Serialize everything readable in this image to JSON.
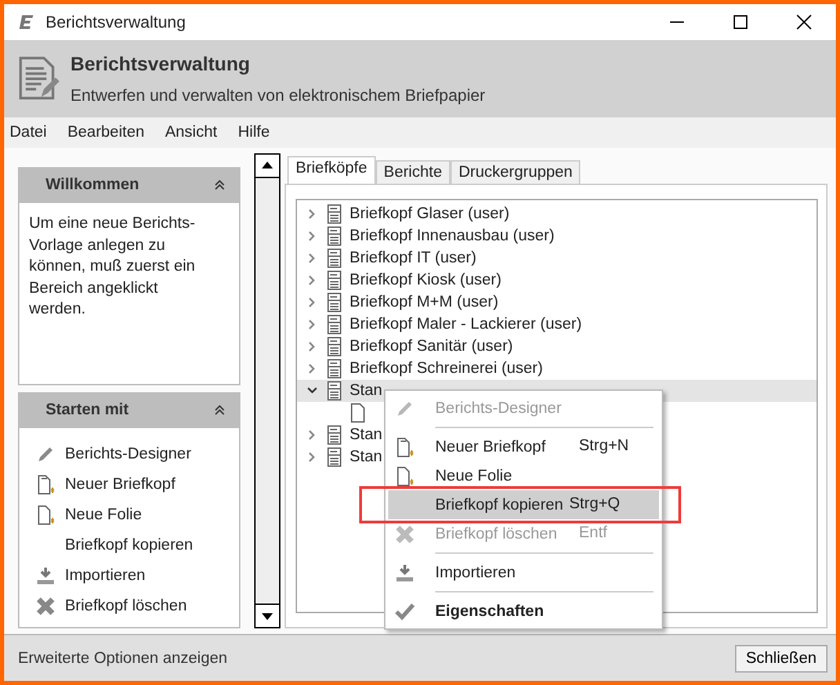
{
  "window": {
    "title": "Berichtsverwaltung"
  },
  "header": {
    "title": "Berichtsverwaltung",
    "subtitle": "Entwerfen und verwalten von elektronischem Briefpapier"
  },
  "menu": [
    "Datei",
    "Bearbeiten",
    "Ansicht",
    "Hilfe"
  ],
  "panels": [
    {
      "title": "Willkommen",
      "expanded": true,
      "kind": "text",
      "text": "Um eine neue Berichts-Vorlage anlegen zu können, muß zuerst ein Bereich angeklickt werden."
    },
    {
      "title": "Starten mit",
      "expanded": true,
      "kind": "actions",
      "items": [
        {
          "label": "Berichts-Designer",
          "kind": "pencil"
        },
        {
          "label": "Neuer Briefkopf",
          "kind": "newdoc"
        },
        {
          "label": "Neue Folie",
          "kind": "newpage"
        },
        {
          "label": "Briefkopf kopieren",
          "kind": "plain"
        },
        {
          "label": "Importieren",
          "kind": "import"
        },
        {
          "label": "Briefkopf löschen",
          "kind": "delete"
        }
      ]
    }
  ],
  "tabs": [
    {
      "label": "Briefköpfe",
      "selected": true
    },
    {
      "label": "Berichte",
      "selected": false
    },
    {
      "label": "Druckergruppen",
      "selected": false
    }
  ],
  "tree": [
    {
      "label": "Briefkopf Glaser (user)",
      "expanded": false,
      "selected": false
    },
    {
      "label": "Briefkopf Innenausbau (user)",
      "expanded": false,
      "selected": false
    },
    {
      "label": "Briefkopf IT (user)",
      "expanded": false,
      "selected": false
    },
    {
      "label": "Briefkopf Kiosk (user)",
      "expanded": false,
      "selected": false
    },
    {
      "label": "Briefkopf M+M (user)",
      "expanded": false,
      "selected": false
    },
    {
      "label": "Briefkopf Maler - Lackierer (user)",
      "expanded": false,
      "selected": false
    },
    {
      "label": "Briefkopf Sanitär (user)",
      "expanded": false,
      "selected": false
    },
    {
      "label": "Briefkopf Schreinerei (user)",
      "expanded": false,
      "selected": false
    },
    {
      "label": "Stan",
      "expanded": true,
      "selected": true,
      "children": [
        {
          "kind": "page"
        }
      ]
    },
    {
      "label": "Stan",
      "expanded": false,
      "selected": false
    },
    {
      "label": "Stan",
      "expanded": false,
      "selected": false
    }
  ],
  "context_menu": [
    {
      "label": "Berichts-Designer",
      "kind": "pencil",
      "disabled": true,
      "highlighted": false,
      "default": false
    },
    {
      "label": "Neuer Briefkopf",
      "shortcut": "Strg+N",
      "kind": "newdoc",
      "disabled": false,
      "highlighted": false,
      "default": false,
      "separator_before": true
    },
    {
      "label": "Neue Folie",
      "kind": "newpage",
      "disabled": false,
      "highlighted": false,
      "default": false
    },
    {
      "label": "Briefkopf kopieren",
      "shortcut": "Strg+Q",
      "kind": "plain",
      "disabled": false,
      "highlighted": true,
      "marked": true,
      "default": false
    },
    {
      "label": "Briefkopf löschen",
      "shortcut": "Entf",
      "kind": "delete",
      "disabled": true,
      "highlighted": false,
      "default": false
    },
    {
      "label": "Importieren",
      "kind": "import",
      "disabled": false,
      "highlighted": false,
      "default": false,
      "separator_before": true
    },
    {
      "label": "Eigenschaften",
      "kind": "check",
      "disabled": false,
      "highlighted": false,
      "default": true,
      "separator_before": true
    }
  ],
  "footer": {
    "link": "Erweiterte Optionen anzeigen",
    "button": "Schließen"
  }
}
